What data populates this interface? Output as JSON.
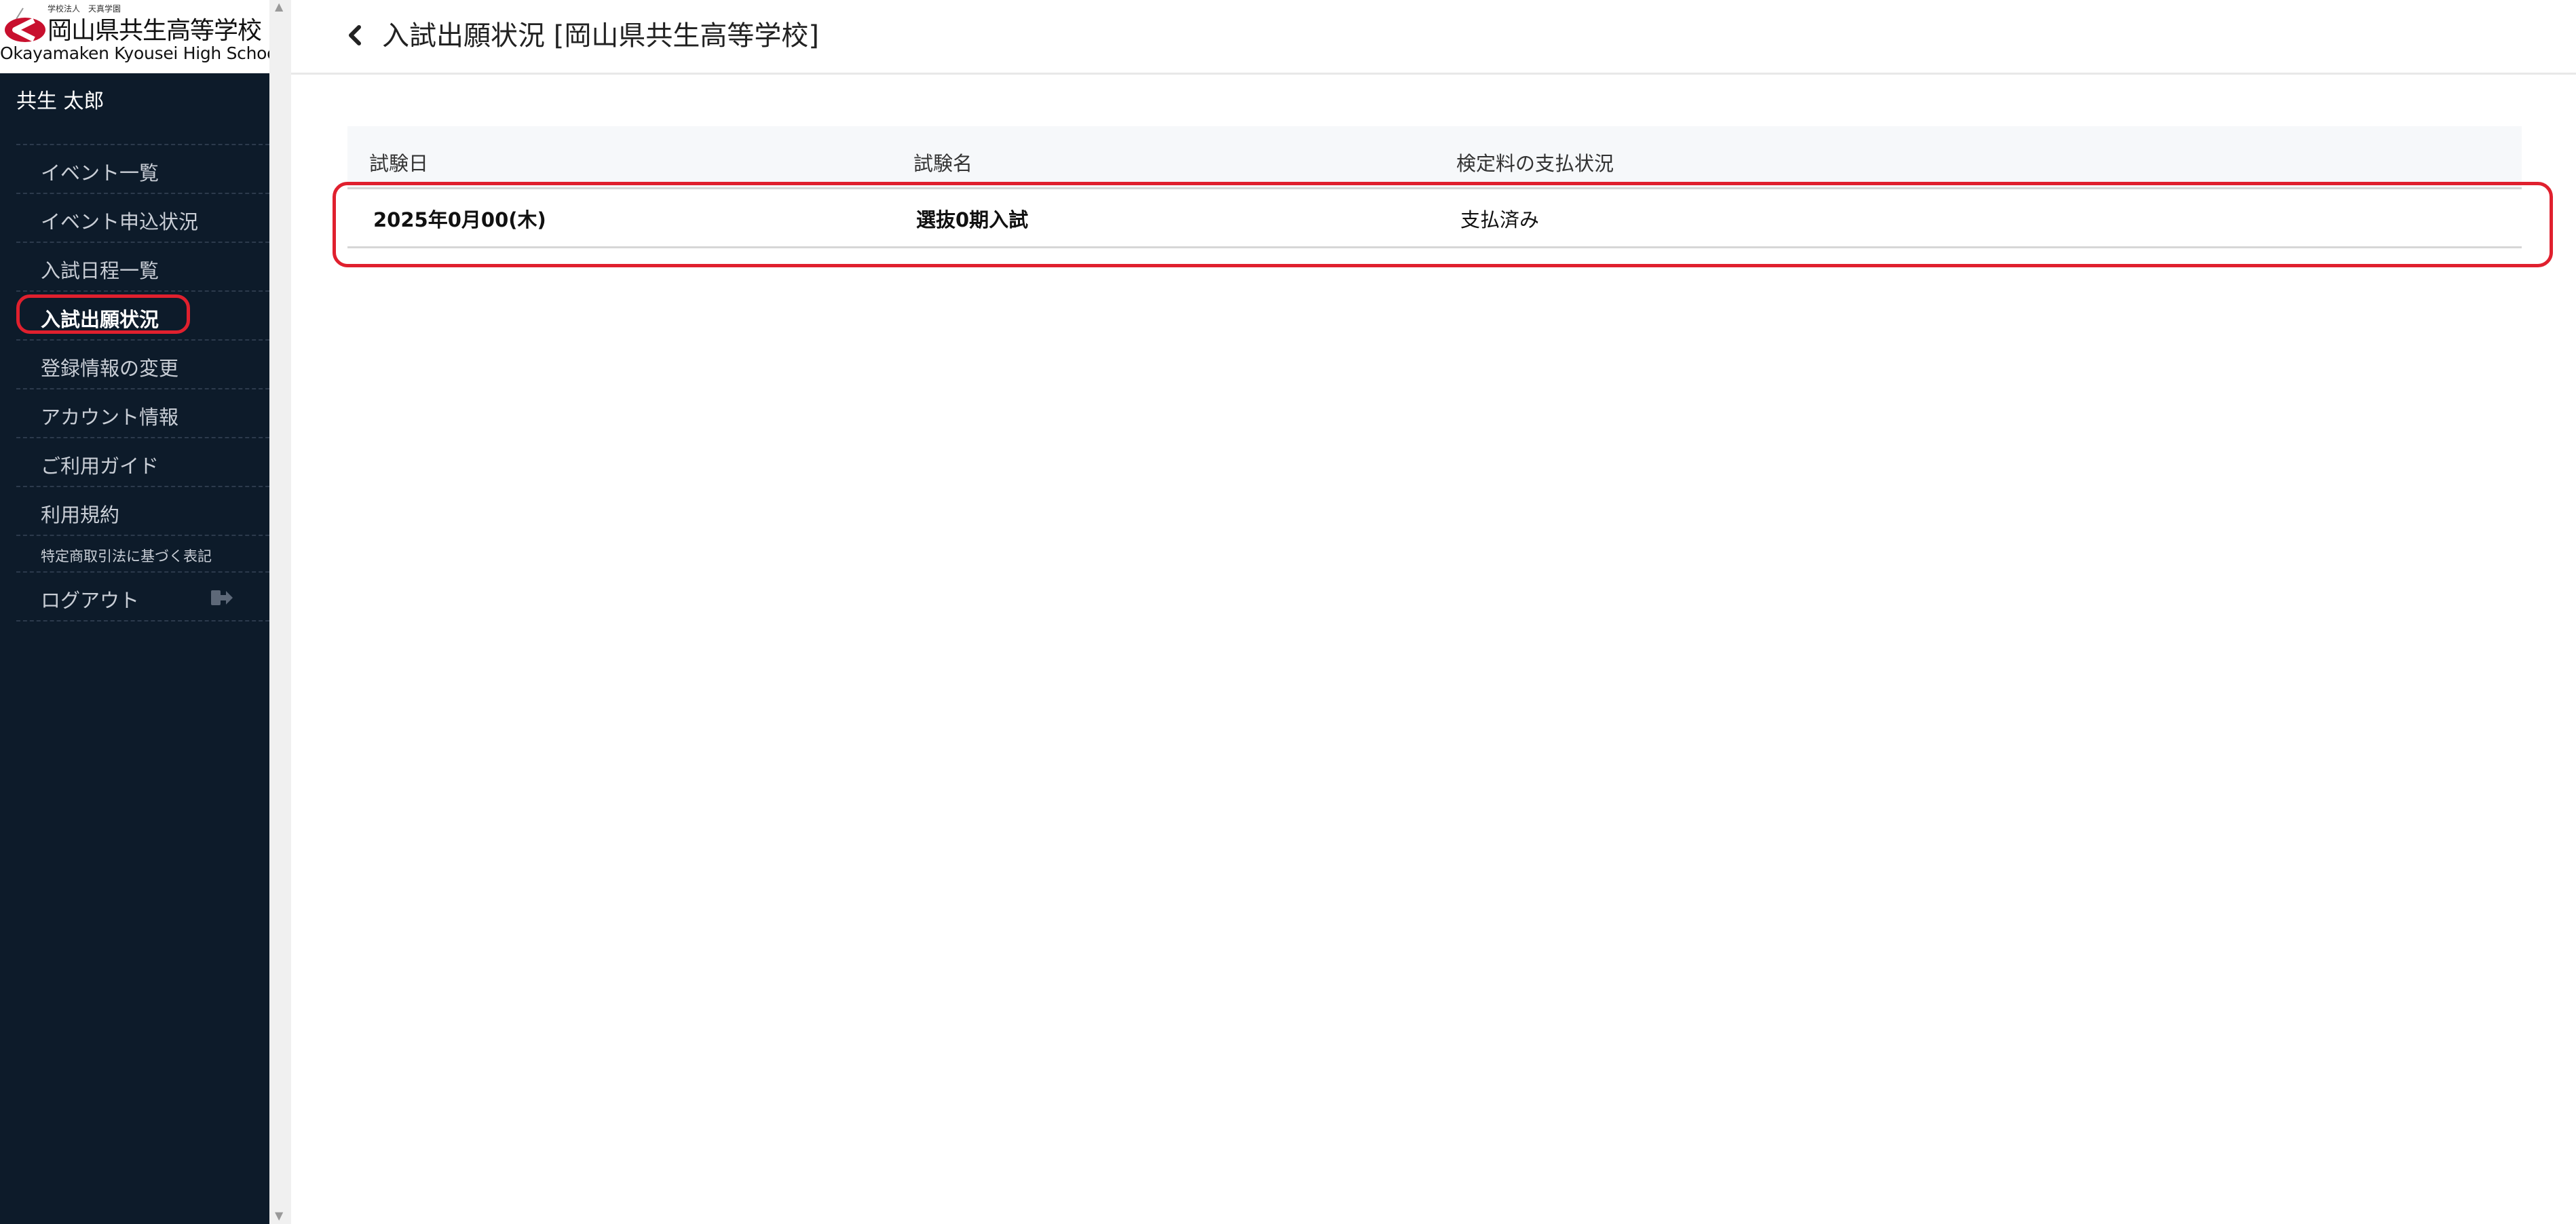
{
  "brand": {
    "kicker": "学校法人　天真学園",
    "name_jp": "岡山県共生高等学校",
    "name_en": "Okayamaken Kyousei High School",
    "accent": "#c8102e"
  },
  "sidebar": {
    "user_name": "共生 太郎",
    "items": [
      {
        "label": "イベント一覧"
      },
      {
        "label": "イベント申込状況"
      },
      {
        "label": "入試日程一覧"
      },
      {
        "label": "入試出願状況",
        "active": true
      },
      {
        "label": "登録情報の変更"
      },
      {
        "label": "アカウント情報"
      },
      {
        "label": "ご利用ガイド"
      },
      {
        "label": "利用規約"
      },
      {
        "label": "特定商取引法に基づく表記"
      },
      {
        "label": "ログアウト",
        "icon": "logout-icon"
      }
    ],
    "background": "#0d1b2a"
  },
  "header": {
    "back_icon": "chevron-left-icon",
    "title": "入試出願状況 [岡山県共生高等学校]"
  },
  "table": {
    "columns": [
      "試験日",
      "試験名",
      "検定料の支払状況"
    ],
    "rows": [
      [
        "2025年0月00(木)",
        "選抜0期入試",
        "支払済み"
      ]
    ]
  },
  "highlight_color": "#e0202e"
}
